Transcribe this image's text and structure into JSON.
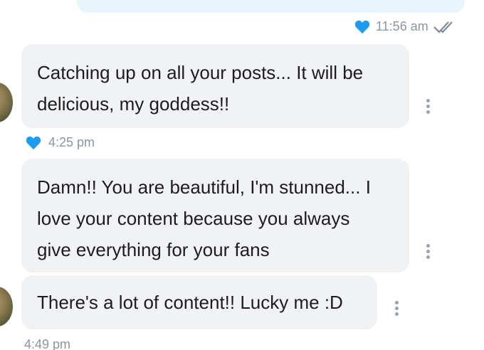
{
  "messages": [
    {
      "text": "Catching up on all your posts... It will be delicious, my goddess!!",
      "lines": [
        "Catching up on all your posts... It will be",
        "delicious, my goddess!!"
      ]
    },
    {
      "text": "Damn!! You are beautiful, I'm stunned... I love your content because you always give everything for your fans",
      "lines": [
        "Damn!! You are beautiful, I'm stunned... I",
        "love your content because you always",
        "give everything for your fans"
      ]
    },
    {
      "text": "There's a lot of content!! Lucky me :D",
      "lines": [
        "There's a lot of content!! Lucky me :D"
      ]
    }
  ],
  "sent_meta": {
    "time": "11:56 am",
    "liked": true,
    "read": true
  },
  "received_meta_1": {
    "time": "4:25 pm",
    "liked": true
  },
  "received_meta_2": {
    "time": "4:49 pm"
  },
  "colors": {
    "accent": "#1d9bf0",
    "bubble_in": "#f1f2f4",
    "bubble_out": "#e7f5fd",
    "meta": "#8a96a3"
  },
  "icons": [
    "heart-icon",
    "double-check-icon",
    "more-vertical-icon",
    "avatar"
  ]
}
